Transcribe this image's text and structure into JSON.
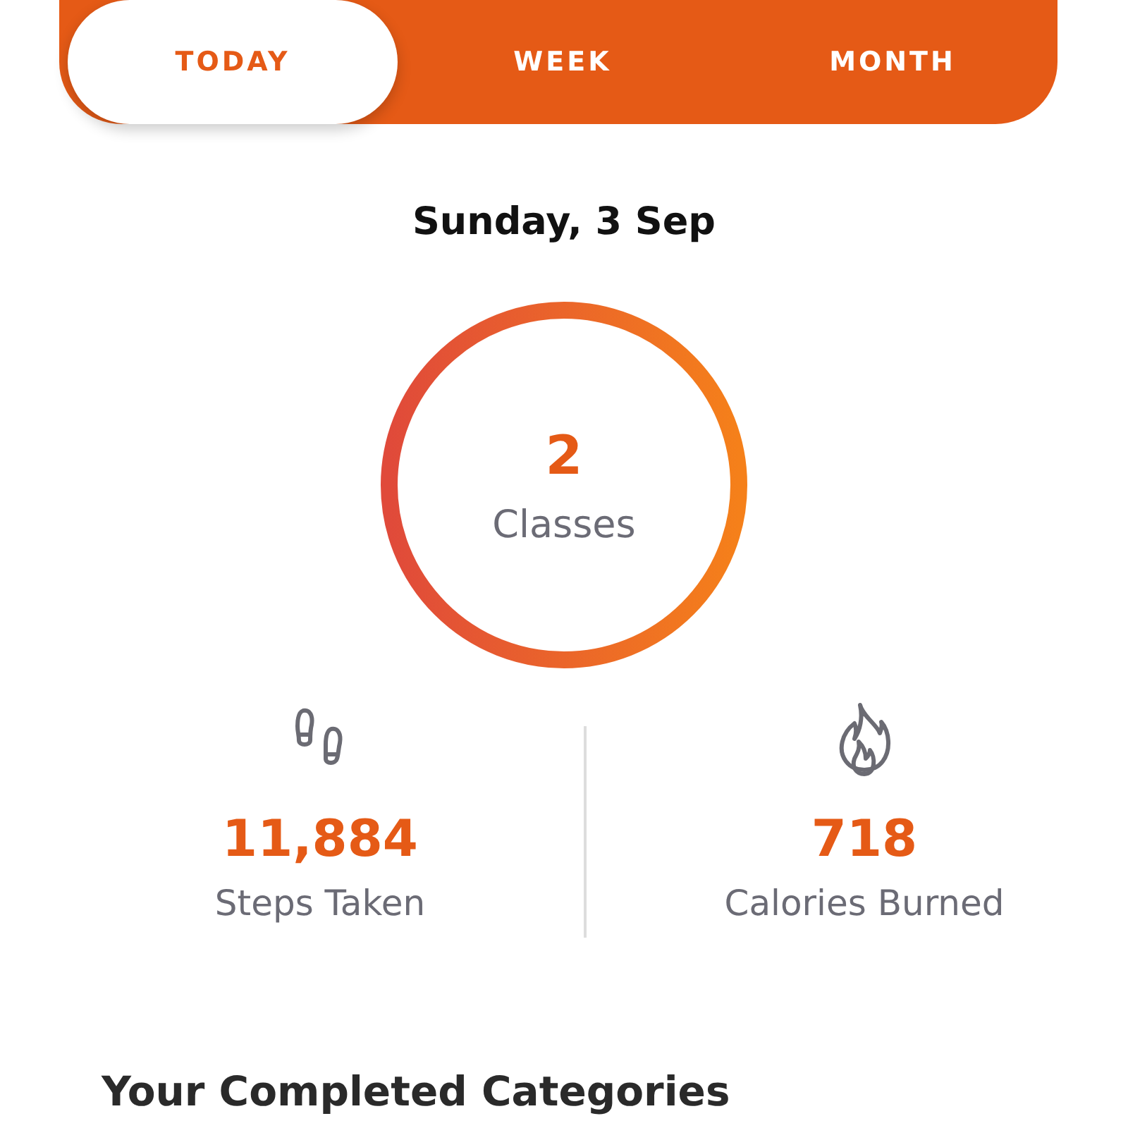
{
  "tabs": [
    {
      "label": "TODAY",
      "selected": true
    },
    {
      "label": "WEEK",
      "selected": false
    },
    {
      "label": "MONTH",
      "selected": false
    }
  ],
  "date": "Sunday, 3 Sep",
  "summary": {
    "value": "2",
    "label": "Classes"
  },
  "stats": [
    {
      "kind": "steps",
      "value": "11,884",
      "label": "Steps Taken"
    },
    {
      "kind": "calories",
      "value": "718",
      "label": "Calories Burned"
    }
  ],
  "section_title": "Your Completed Categories"
}
